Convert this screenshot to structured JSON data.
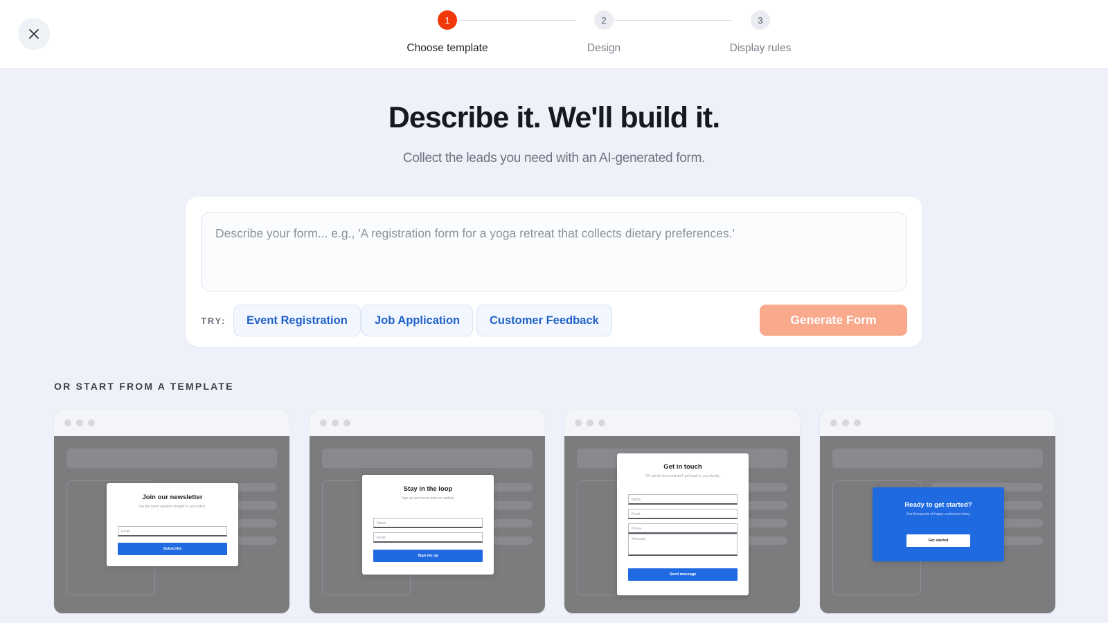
{
  "header": {
    "steps": [
      {
        "number": "1",
        "label": "Choose template",
        "active": true
      },
      {
        "number": "2",
        "label": "Design",
        "active": false
      },
      {
        "number": "3",
        "label": "Display rules",
        "active": false
      }
    ]
  },
  "hero": {
    "title": "Describe it. We'll build it.",
    "subtitle": "Collect the leads you need with an AI-generated form."
  },
  "ai_form": {
    "placeholder": "Describe your form... e.g., 'A registration form for a yoga retreat that collects dietary preferences.'",
    "try_label": "TRY:",
    "suggestions": [
      "Event Registration",
      "Job Application",
      "Customer Feedback"
    ],
    "generate_label": "Generate Form"
  },
  "templates": {
    "section_label": "OR START FROM A TEMPLATE",
    "items": [
      {
        "title": "Join our newsletter",
        "subtitle": "Get the latest updates straight to your inbox.",
        "fields": [
          "Email"
        ],
        "button": "Subscribe"
      },
      {
        "title": "Stay in the loop",
        "subtitle": "Sign up and never miss an update.",
        "fields": [
          "Name",
          "Email"
        ],
        "button": "Sign me up"
      },
      {
        "title": "Get in touch",
        "subtitle": "Fill out the form and we'll get back to you shortly.",
        "fields": [
          "Name",
          "Email",
          "Phone",
          "Message"
        ],
        "button": "Send message"
      },
      {
        "title": "Ready to get started?",
        "subtitle": "Join thousands of happy customers today.",
        "fields": [],
        "button": "Get started"
      }
    ]
  },
  "colors": {
    "accent": "#f0380b",
    "generate_button": "#f9a98c",
    "link_blue": "#2062c9",
    "form_blue": "#1f6ae0",
    "background": "#eef1fa"
  },
  "icons": {
    "close": "close-icon"
  }
}
